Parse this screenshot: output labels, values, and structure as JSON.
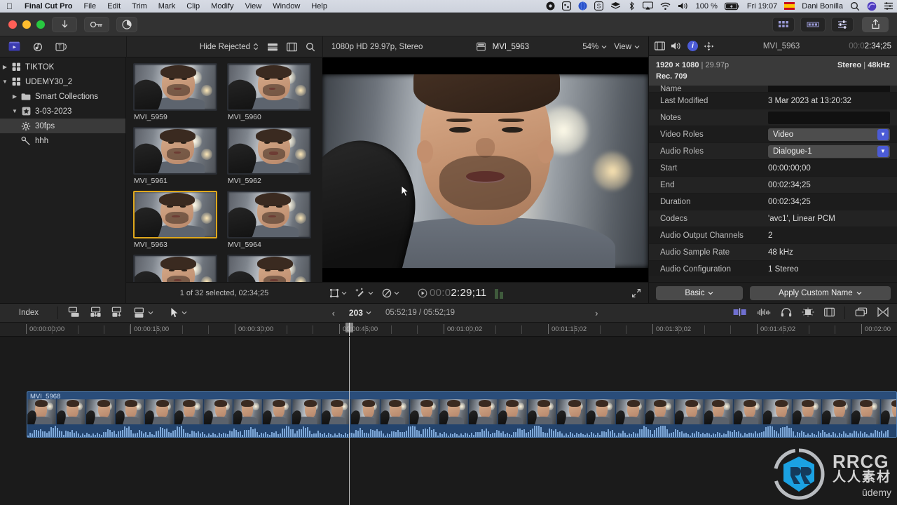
{
  "menubar": {
    "apple_icon": "apple-icon",
    "items": [
      "Final Cut Pro",
      "File",
      "Edit",
      "Trim",
      "Mark",
      "Clip",
      "Modify",
      "View",
      "Window",
      "Help"
    ],
    "status_icons": [
      "record-icon",
      "screencast-icon",
      "globe-icon",
      "dollar-icon",
      "stack-icon",
      "bluetooth-icon",
      "airplay-icon",
      "wifi-icon",
      "volume-icon"
    ],
    "battery_percent": "100 %",
    "battery_icon": "battery-charging-icon",
    "clock": "Fri 19:07",
    "flag_icon": "spain-flag-icon",
    "user": "Dani Bonilla",
    "search_icon": "search-icon",
    "siri_icon": "siri-icon",
    "controlcenter_icon": "control-center-icon"
  },
  "titlebar": {
    "traffic": [
      "close-button",
      "minimize-button",
      "zoom-button"
    ],
    "import_icon": "import-media-icon",
    "keyword_icon": "keyword-editor-icon",
    "background_tasks_icon": "background-tasks-icon",
    "right_buttons": [
      "browser-toggle-icon",
      "timeline-toggle-icon",
      "inspector-toggle-icon"
    ],
    "share_icon": "share-icon"
  },
  "browser_toolbar": {
    "library_icon": "libraries-icon",
    "photos_audio_icon": "photos-audio-icon",
    "titles_generators_icon": "titles-generators-icon",
    "filter_label": "Hide Rejected",
    "list_view_icon": "list-view-icon",
    "filmstrip_view_icon": "filmstrip-view-icon",
    "search_icon": "search-icon",
    "format": "1080p HD 29.97p, Stereo",
    "project_icon": "project-icon",
    "clip_name": "MVI_5963",
    "zoom_level": "54%",
    "view_label": "View"
  },
  "sidebar": {
    "items": [
      {
        "label": "TIKTOK",
        "icon": "library-icon",
        "disclosure": "collapsed",
        "indent": 0,
        "selected": false
      },
      {
        "label": "UDEMY30_2",
        "icon": "library-icon",
        "disclosure": "expanded",
        "indent": 0,
        "selected": false
      },
      {
        "label": "Smart Collections",
        "icon": "folder-icon",
        "disclosure": "collapsed",
        "indent": 1,
        "selected": false
      },
      {
        "label": "3-03-2023",
        "icon": "event-star-icon",
        "disclosure": "expanded",
        "indent": 1,
        "selected": false
      },
      {
        "label": "30fps",
        "icon": "keyword-collection-icon",
        "disclosure": "none",
        "indent": 2,
        "selected": true
      },
      {
        "label": "hhh",
        "icon": "smart-collection-icon",
        "disclosure": "none",
        "indent": 2,
        "selected": false
      }
    ]
  },
  "browser": {
    "clips": [
      {
        "name": "MVI_5959",
        "selected": false
      },
      {
        "name": "MVI_5960",
        "selected": false
      },
      {
        "name": "MVI_5961",
        "selected": false
      },
      {
        "name": "MVI_5962",
        "selected": false
      },
      {
        "name": "MVI_5963",
        "selected": true
      },
      {
        "name": "MVI_5964",
        "selected": false
      },
      {
        "name": "",
        "selected": false
      },
      {
        "name": "",
        "selected": false
      }
    ],
    "status": "1 of 32 selected, 02:34;25"
  },
  "viewer": {
    "transform_icon": "transform-icon",
    "effects_icon": "enhancements-icon",
    "retime_icon": "retime-icon",
    "play_icon": "play-icon",
    "timecode_dim": "00:0",
    "timecode": "2:29;11",
    "fullscreen_icon": "fullscreen-icon"
  },
  "inspector": {
    "tabs": [
      "video-inspector-icon",
      "audio-inspector-icon",
      "info-inspector-icon",
      "share-inspector-icon"
    ],
    "active_tab": "info-inspector-icon",
    "title": "MVI_5963",
    "timecode_dim": "00:0",
    "timecode": "2:34;25",
    "summary": {
      "resolution": "1920 × 1080",
      "framerate": "29.97p",
      "audio_channels": "Stereo",
      "sample_rate": "48kHz",
      "colorspace": "Rec. 709"
    },
    "rows": [
      {
        "label": "Name",
        "value": "",
        "type": "field",
        "clipped": true
      },
      {
        "label": "Last Modified",
        "value": "3 Mar 2023 at 13:20:32",
        "type": "text"
      },
      {
        "label": "Notes",
        "value": "",
        "type": "field"
      },
      {
        "label": "Video Roles",
        "value": "Video",
        "type": "popup"
      },
      {
        "label": "Audio Roles",
        "value": "Dialogue-1",
        "type": "popup"
      },
      {
        "label": "Start",
        "value": "00:00:00;00",
        "type": "text"
      },
      {
        "label": "End",
        "value": "00:02:34;25",
        "type": "text"
      },
      {
        "label": "Duration",
        "value": "00:02:34;25",
        "type": "text"
      },
      {
        "label": "Codecs",
        "value": "'avc1', Linear PCM",
        "type": "text"
      },
      {
        "label": "Audio Output Channels",
        "value": "2",
        "type": "text"
      },
      {
        "label": "Audio Sample Rate",
        "value": "48 kHz",
        "type": "text"
      },
      {
        "label": "Audio Configuration",
        "value": "1 Stereo",
        "type": "text"
      }
    ],
    "metadata_view_button": "Basic",
    "apply_name_button": "Apply Custom Name"
  },
  "timeline_toolbar": {
    "index_label": "Index",
    "edit_icons": [
      "connect-icon",
      "insert-icon",
      "append-icon",
      "overwrite-icon"
    ],
    "tool_icon": "select-tool-icon",
    "prev_icon": "previous-icon",
    "next_icon": "next-icon",
    "clip_count": "203",
    "duration": "05:52;19 / 05:52;19",
    "right_icons": [
      "trim-icon",
      "audio-meters-icon",
      "headphones-icon",
      "solo-icon",
      "clip-appearance-icon",
      "detach-icon",
      "rename-icon"
    ]
  },
  "ruler": {
    "labels": [
      "00:00:00;00",
      "00:00:15;00",
      "00:00:30;00",
      "00:00:45;00",
      "00:01:00;02",
      "00:01:15;02",
      "00:01:30;02",
      "00:01:45;02",
      "00:02:00"
    ]
  },
  "timeline": {
    "clip_name": "MVI_5968"
  },
  "watermark": {
    "brand": "RRCG",
    "brand_cn": "人人素材",
    "platform": "ûdemy"
  },
  "colors": {
    "accent_blue": "#4b5bd6",
    "selection_yellow": "#e0a81c",
    "clip_blue": "#2a4d7a",
    "menubar_bg": "#d7dbe4"
  }
}
